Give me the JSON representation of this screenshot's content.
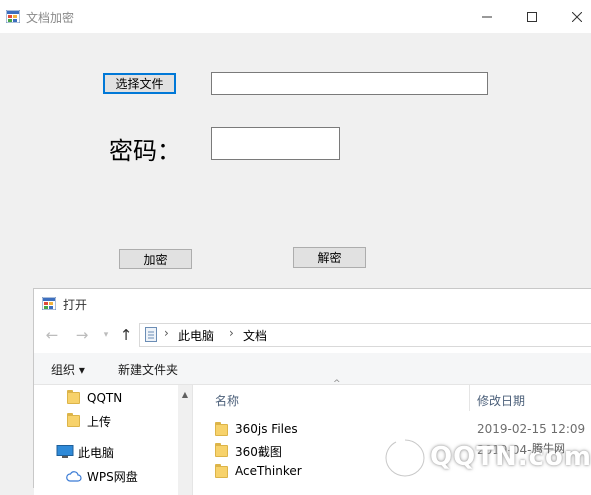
{
  "main_window": {
    "title": "文档加密",
    "controls": [
      "minimize",
      "maximize",
      "close"
    ]
  },
  "form": {
    "choose_file_label": "选择文件",
    "file_path_value": "",
    "password_label": "密码：",
    "password_value": "",
    "encrypt_label": "加密",
    "decrypt_label": "解密"
  },
  "open_dialog": {
    "title": "打开",
    "breadcrumb": [
      "此电脑",
      "文档"
    ],
    "toolbar": {
      "organize_label": "组织 ▾",
      "new_folder_label": "新建文件夹"
    },
    "nav_pane": [
      {
        "label": "QQTN",
        "icon": "folder-icon"
      },
      {
        "label": "上传",
        "icon": "folder-icon"
      },
      {
        "label": "此电脑",
        "icon": "computer-icon"
      },
      {
        "label": "WPS网盘",
        "icon": "cloud-icon"
      }
    ],
    "columns": {
      "name": "名称",
      "date": "修改日期"
    },
    "files": [
      {
        "name": "360js Files",
        "date": "2019-02-15 12:09"
      },
      {
        "name": "360截图",
        "date": "2019-04-"
      },
      {
        "name": "AceThinker",
        "date": ""
      }
    ]
  },
  "watermark": {
    "text": "QQTN.com",
    "sub": "腾牛网"
  },
  "colors": {
    "accent": "#0078d7",
    "window_bg": "#f0f0f0",
    "folder": "#f7d26b"
  }
}
